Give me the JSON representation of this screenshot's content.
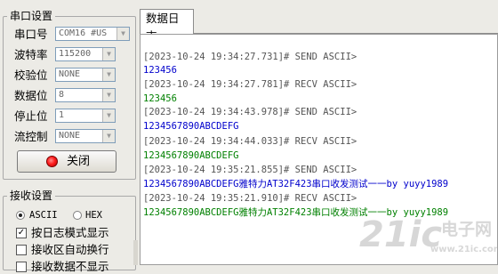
{
  "serial_settings": {
    "title": "串口设置",
    "port_label": "串口号",
    "port_value": "COM16 #US",
    "baud_label": "波特率",
    "baud_value": "115200",
    "parity_label": "校验位",
    "parity_value": "NONE",
    "databits_label": "数据位",
    "databits_value": "8",
    "stopbits_label": "停止位",
    "stopbits_value": "1",
    "flow_label": "流控制",
    "flow_value": "NONE",
    "close_label": "关闭"
  },
  "receive_settings": {
    "title": "接收设置",
    "ascii_label": "ASCII",
    "hex_label": "HEX",
    "log_mode_label": "按日志模式显示",
    "auto_wrap_label": "接收区自动换行",
    "fourth_label": "接收数据不显示"
  },
  "tabs": [
    {
      "label": "数据日志"
    }
  ],
  "log": [
    {
      "text": "[2023-10-24 19:34:27.731]# SEND ASCII>",
      "color": "#555555"
    },
    {
      "text": "123456",
      "color": "#0000cc"
    },
    {
      "text": "[2023-10-24 19:34:27.781]# RECV ASCII>",
      "color": "#555555"
    },
    {
      "text": "123456",
      "color": "#008000"
    },
    {
      "text": "[2023-10-24 19:34:43.978]# SEND ASCII>",
      "color": "#555555"
    },
    {
      "text": "1234567890ABCDEFG",
      "color": "#0000cc"
    },
    {
      "text": "[2023-10-24 19:34:44.033]# RECV ASCII>",
      "color": "#555555"
    },
    {
      "text": "1234567890ABCDEFG",
      "color": "#008000"
    },
    {
      "text": "[2023-10-24 19:35:21.855]# SEND ASCII>",
      "color": "#555555"
    },
    {
      "text": "1234567890ABCDEFG雅特力AT32F423串口收发测试一一by yuyy1989",
      "color": "#0000cc"
    },
    {
      "text": "[2023-10-24 19:35:21.910]# RECV ASCII>",
      "color": "#555555"
    },
    {
      "text": "1234567890ABCDEFG雅特力AT32F423串口收发测试一一by yuyy1989",
      "color": "#008000"
    }
  ],
  "watermark": {
    "logo": "21ic",
    "cn": "电子网",
    "url": "www.21ic.com"
  }
}
